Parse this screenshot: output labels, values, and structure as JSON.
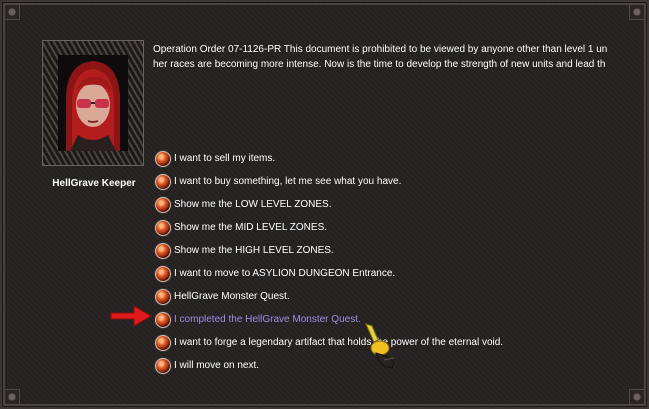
{
  "npc": {
    "name": "HellGrave Keeper",
    "portrait": "red-haired-character-with-sunglasses"
  },
  "dialog": {
    "line1": "Operation Order 07-1126-PR This document is prohibited to be viewed by anyone other than level 1 un",
    "line2": "her races are becoming more intense. Now is the time to develop the strength of new units and lead th"
  },
  "options": [
    {
      "label": "I want to sell my items."
    },
    {
      "label": "I want to buy something, let me see what you have."
    },
    {
      "label": "Show me the LOW LEVEL ZONES."
    },
    {
      "label": "Show me the MID LEVEL ZONES."
    },
    {
      "label": "Show me the HIGH LEVEL ZONES."
    },
    {
      "label": "I want to move to ASYLION DUNGEON Entrance."
    },
    {
      "label": "HellGrave Monster Quest."
    },
    {
      "label": "I completed the HellGrave Monster Quest.",
      "selected": true
    },
    {
      "label": "I want to forge a legendary artifact that holds the power of the eternal void."
    },
    {
      "label": "I will move on next."
    }
  ],
  "colors": {
    "text": "#ffffff",
    "selected_text": "#9a8fe6",
    "arrow": "#e0191b",
    "orb": "#d85a27"
  },
  "icons": {
    "pointer": "red-arrow-icon",
    "cursor": "golden-hand-cursor-icon"
  }
}
